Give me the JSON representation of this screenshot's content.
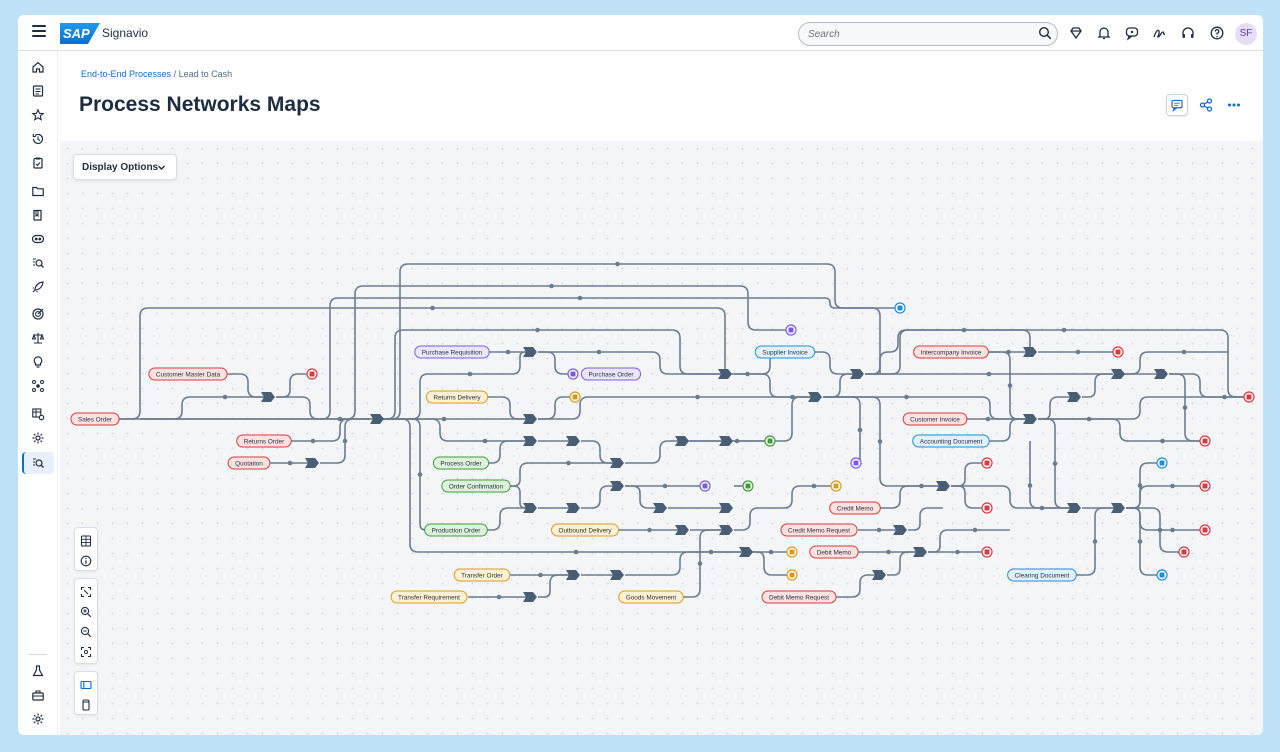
{
  "app": {
    "brand_logo": "SAP",
    "product": "Signavio"
  },
  "search": {
    "placeholder": "Search"
  },
  "user": {
    "initials": "SF"
  },
  "breadcrumb": {
    "parent": "End-to-End Processes",
    "separator": "/",
    "current": "Lead to Cash"
  },
  "page": {
    "title": "Process Networks Maps"
  },
  "toolbar": {
    "display_options_label": "Display Options"
  },
  "header_icons": [
    "search-icon",
    "gem-icon",
    "bell-icon",
    "chat-icon",
    "signature-icon",
    "headset-icon",
    "help-icon"
  ],
  "nav_icons": [
    "home-icon",
    "document-icon",
    "star-icon",
    "history-icon",
    "clipboard-icon",
    "folder-icon",
    "book-icon",
    "eye-icon",
    "search-doc-icon",
    "rocket-icon",
    "target-icon",
    "balance-icon",
    "lightbulb-icon",
    "hub-icon",
    "table-gear-icon",
    "settings-icon",
    "process-search-icon",
    "flask-icon",
    "toolbox-icon",
    "gear-icon"
  ],
  "colors": {
    "accent": "#0a6ed1",
    "edge": "#6a7c90",
    "step": "#475e75",
    "red_fill": "#fde2e2",
    "red_stroke": "#d9393f",
    "purple_fill": "#ece6fb",
    "purple_stroke": "#7b5be0",
    "orange_fill": "#fff1d6",
    "orange_stroke": "#d99a1c",
    "green_fill": "#dff3dc",
    "green_stroke": "#3f9c3a",
    "blue_fill": "#e2f1fc",
    "blue_stroke": "#1b90d9"
  },
  "network": {
    "nodes": [
      {
        "label": "Sales Order",
        "color": "red"
      },
      {
        "label": "Customer Master Data",
        "color": "red"
      },
      {
        "label": "Returns Order",
        "color": "red"
      },
      {
        "label": "Quotation",
        "color": "red"
      },
      {
        "label": "Purchase Requisition",
        "color": "purple"
      },
      {
        "label": "Purchase Order",
        "color": "purple"
      },
      {
        "label": "Returns Delivery",
        "color": "orange"
      },
      {
        "label": "Process Order",
        "color": "green"
      },
      {
        "label": "Order Confirmation",
        "color": "green"
      },
      {
        "label": "Production Order",
        "color": "green"
      },
      {
        "label": "Outbound Delivery",
        "color": "orange"
      },
      {
        "label": "Transfer Order",
        "color": "orange"
      },
      {
        "label": "Transfer Requirement",
        "color": "orange"
      },
      {
        "label": "Goods Movement",
        "color": "orange"
      },
      {
        "label": "Supplier Invoice",
        "color": "blue"
      },
      {
        "label": "Intercompany Invoice",
        "color": "red"
      },
      {
        "label": "Customer Invoice",
        "color": "red"
      },
      {
        "label": "Accounting Document",
        "color": "blue"
      },
      {
        "label": "Credit Memo",
        "color": "red"
      },
      {
        "label": "Credit Memo Request",
        "color": "red"
      },
      {
        "label": "Debit Memo",
        "color": "red"
      },
      {
        "label": "Debit Memo Request",
        "color": "red"
      },
      {
        "label": "Clearing Document",
        "color": "blue"
      }
    ]
  }
}
